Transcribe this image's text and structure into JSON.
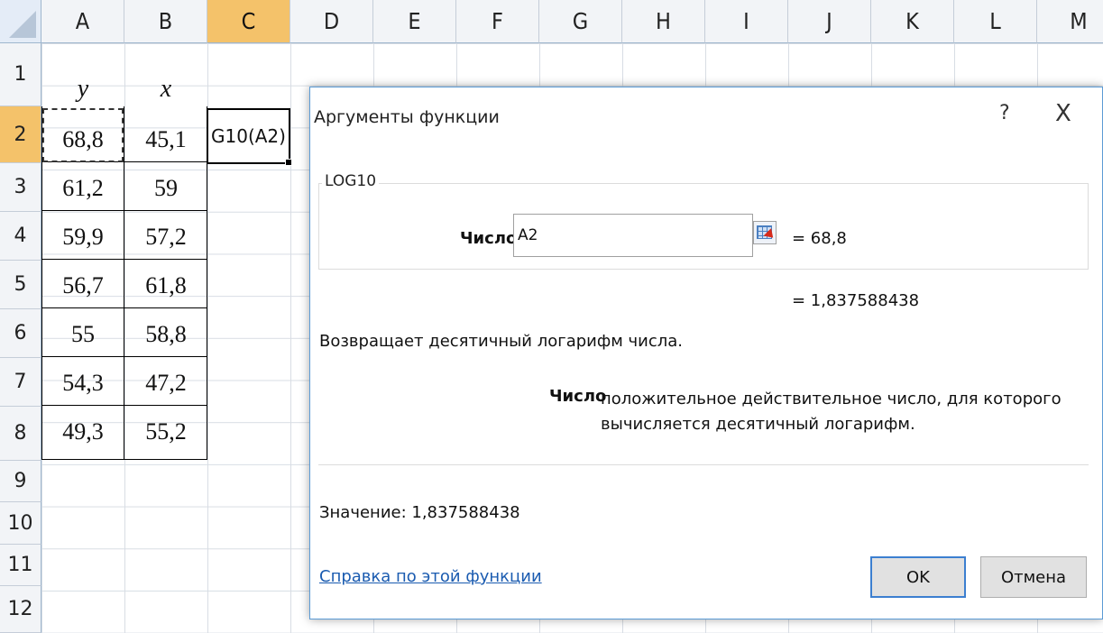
{
  "sheet": {
    "columns": [
      "A",
      "B",
      "C",
      "D",
      "E",
      "F",
      "G",
      "H",
      "I",
      "J",
      "K",
      "L",
      "M"
    ],
    "rows": [
      "1",
      "2",
      "3",
      "4",
      "5",
      "6",
      "7",
      "8",
      "9",
      "10",
      "11",
      "12"
    ],
    "selected_column": "C",
    "selected_row": "2",
    "table": {
      "header": {
        "y": "y",
        "x": "x"
      },
      "rows": [
        {
          "y": "68,8",
          "x": "45,1"
        },
        {
          "y": "61,2",
          "x": "59"
        },
        {
          "y": "59,9",
          "x": "57,2"
        },
        {
          "y": "56,7",
          "x": "61,8"
        },
        {
          "y": "55",
          "x": "58,8"
        },
        {
          "y": "54,3",
          "x": "47,2"
        },
        {
          "y": "49,3",
          "x": "55,2"
        }
      ]
    },
    "active_cell_text": "G10(A2)"
  },
  "dialog": {
    "title": "Аргументы функции",
    "help_glyph": "?",
    "close_glyph": "X",
    "function_name": "LOG10",
    "arg_label": "Число",
    "arg_input_value": "A2",
    "arg_value": "=  68,8",
    "result_value": "=  1,837588438",
    "description": "Возвращает десятичный логарифм числа.",
    "param_name": "Число",
    "param_description": "положительное действительное число, для которого вычисляется десятичный логарифм.",
    "value_line": "Значение:   1,837588438",
    "help_link": "Справка по этой функции",
    "ok_label": "OK",
    "cancel_label": "Отмена"
  }
}
